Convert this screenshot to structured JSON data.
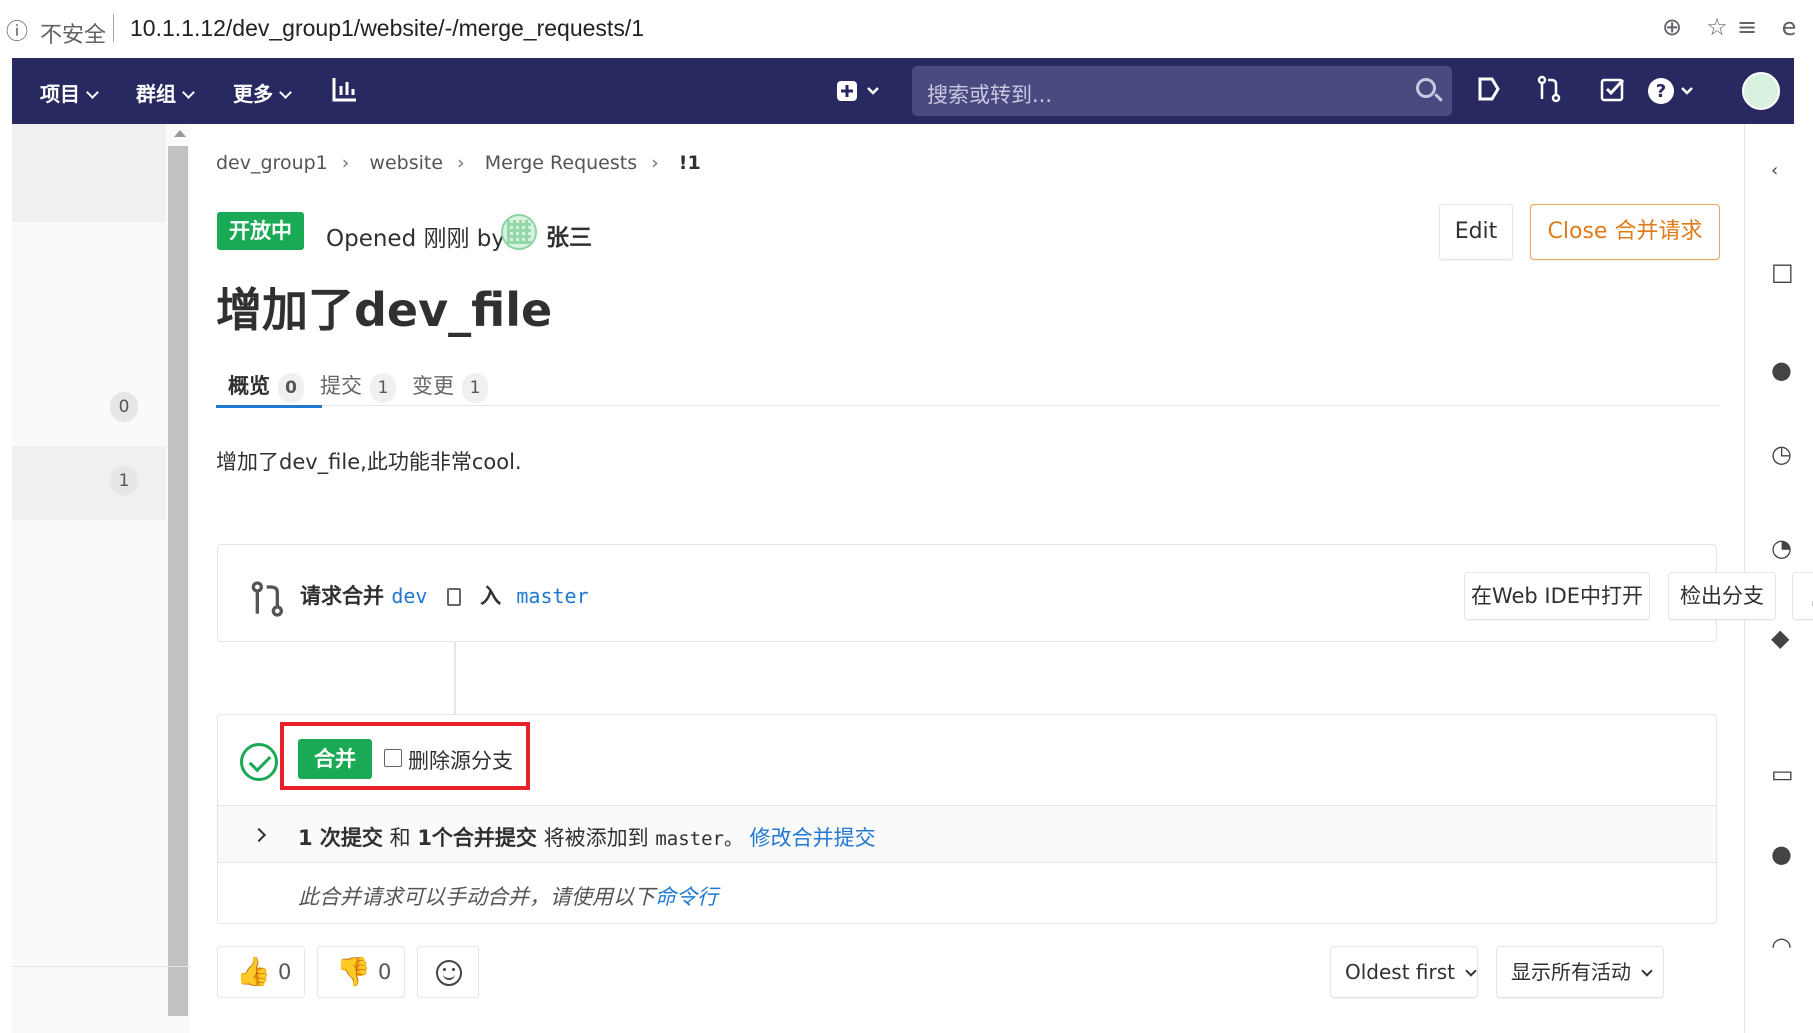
{
  "browser": {
    "insecure_label": "不安全",
    "url": "10.1.1.12/dev_group1/website/-/merge_requests/1"
  },
  "navbar": {
    "menus": [
      "项目",
      "群组",
      "更多"
    ],
    "search_placeholder": "搜索或转到..."
  },
  "sidebar": {
    "counts": [
      "0",
      "1"
    ]
  },
  "breadcrumb": [
    "dev_group1",
    "website",
    "Merge Requests",
    "!1"
  ],
  "mr": {
    "status": "开放中",
    "opened_text": "Opened 刚刚 by",
    "author": "张三",
    "edit_label": "Edit",
    "close_label": "Close 合并请求",
    "title": "增加了dev_file",
    "tabs": [
      {
        "label": "概览",
        "count": "0"
      },
      {
        "label": "提交",
        "count": "1"
      },
      {
        "label": "变更",
        "count": "1"
      }
    ],
    "description": "增加了dev_file,此功能非常cool."
  },
  "widget": {
    "request_merge": "请求合并",
    "source_branch": "dev",
    "into": "入",
    "target_branch": "master",
    "webide_label": "在Web IDE中打开",
    "checkout_label": "检出分支",
    "merge_label": "合并",
    "delete_source_label": "删除源分支",
    "commits_count": "1 次提交",
    "and": "和",
    "merge_commit": "1个合并提交",
    "will_add": "将被添加到",
    "target": "master。",
    "modify_link": "修改合并提交",
    "manual_text": "此合并请求可以手动合并，请使用以下",
    "cli_link": "命令行"
  },
  "reactions": {
    "thumbs_up": "0",
    "thumbs_down": "0"
  },
  "filters": {
    "sort_label": "Oldest first",
    "activity_label": "显示所有活动"
  },
  "colors": {
    "nav_bg": "#292961",
    "success": "#1aaa55",
    "link": "#1f78d1",
    "warning": "#e07b1c",
    "highlight": "#e8202a"
  }
}
